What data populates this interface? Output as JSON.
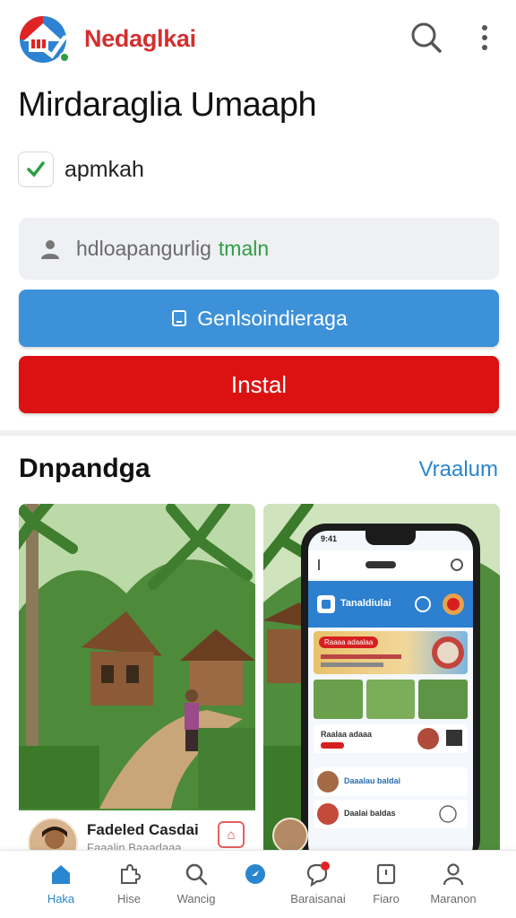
{
  "header": {
    "brand": "Nedaglkai",
    "app_title": "Mirdaraglia Umaaph",
    "verified_label": "apmkah"
  },
  "search": {
    "placeholder": "hdloapangurlig",
    "placeholder_highlight": "tmaln"
  },
  "buttons": {
    "primary_label": "Genlsoindieraga",
    "install_label": "Instal"
  },
  "section": {
    "title": "Dnpandga",
    "link": "Vraalum"
  },
  "cards": [
    {
      "name": "Fadeled Casdai",
      "sub": "Faaalin Baaadaaa"
    },
    {
      "phone": {
        "time": "9:41",
        "header": "Tanaldiulai",
        "banner_pill": "Raaaa adaalaa",
        "row1": "Raalaa adaaa",
        "row2": "Daaalau baldai",
        "row3": "Daalai baldas"
      }
    }
  ],
  "nav": [
    {
      "label": "Haka",
      "icon": "home-icon",
      "active": true
    },
    {
      "label": "Hise",
      "icon": "puzzle-icon",
      "active": false
    },
    {
      "label": "Wancig",
      "icon": "search-icon",
      "active": false
    },
    {
      "label": "",
      "icon": "compass-icon",
      "active": false
    },
    {
      "label": "Baraisanai",
      "icon": "chat-icon",
      "active": false
    },
    {
      "label": "Fiaro",
      "icon": "bookmark-icon",
      "active": false
    },
    {
      "label": "Maranon",
      "icon": "profile-icon",
      "active": false
    }
  ],
  "colors": {
    "brand_red": "#d32f2f",
    "primary_blue": "#3d91d8",
    "install_red": "#dc1212",
    "link_blue": "#2a86cf",
    "verified_green": "#2e9e44"
  }
}
